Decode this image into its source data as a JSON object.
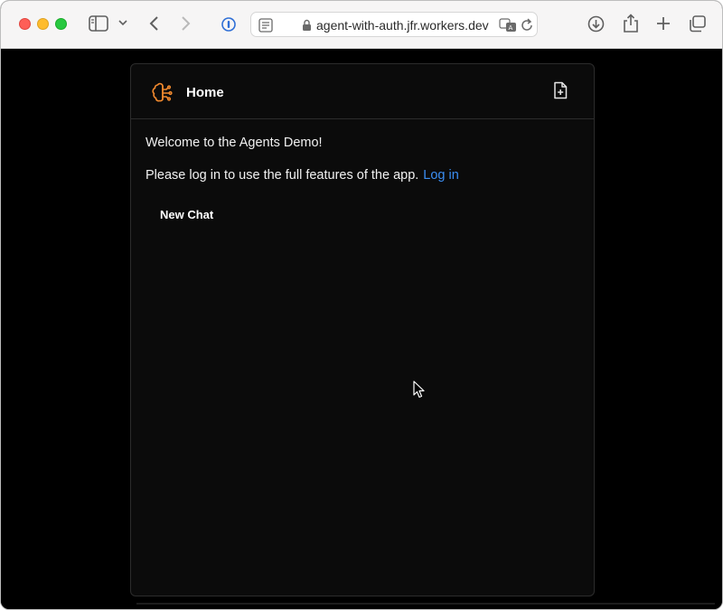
{
  "browser": {
    "url": "agent-with-auth.jfr.workers.dev"
  },
  "app": {
    "header_title": "Home",
    "welcome_text": "Welcome to the Agents Demo!",
    "login_prompt": "Please log in to use the full features of the app.",
    "login_link": "Log in",
    "new_chat_label": "New Chat",
    "accent_color": "#f28a2e",
    "link_color": "#3b8ef3"
  }
}
